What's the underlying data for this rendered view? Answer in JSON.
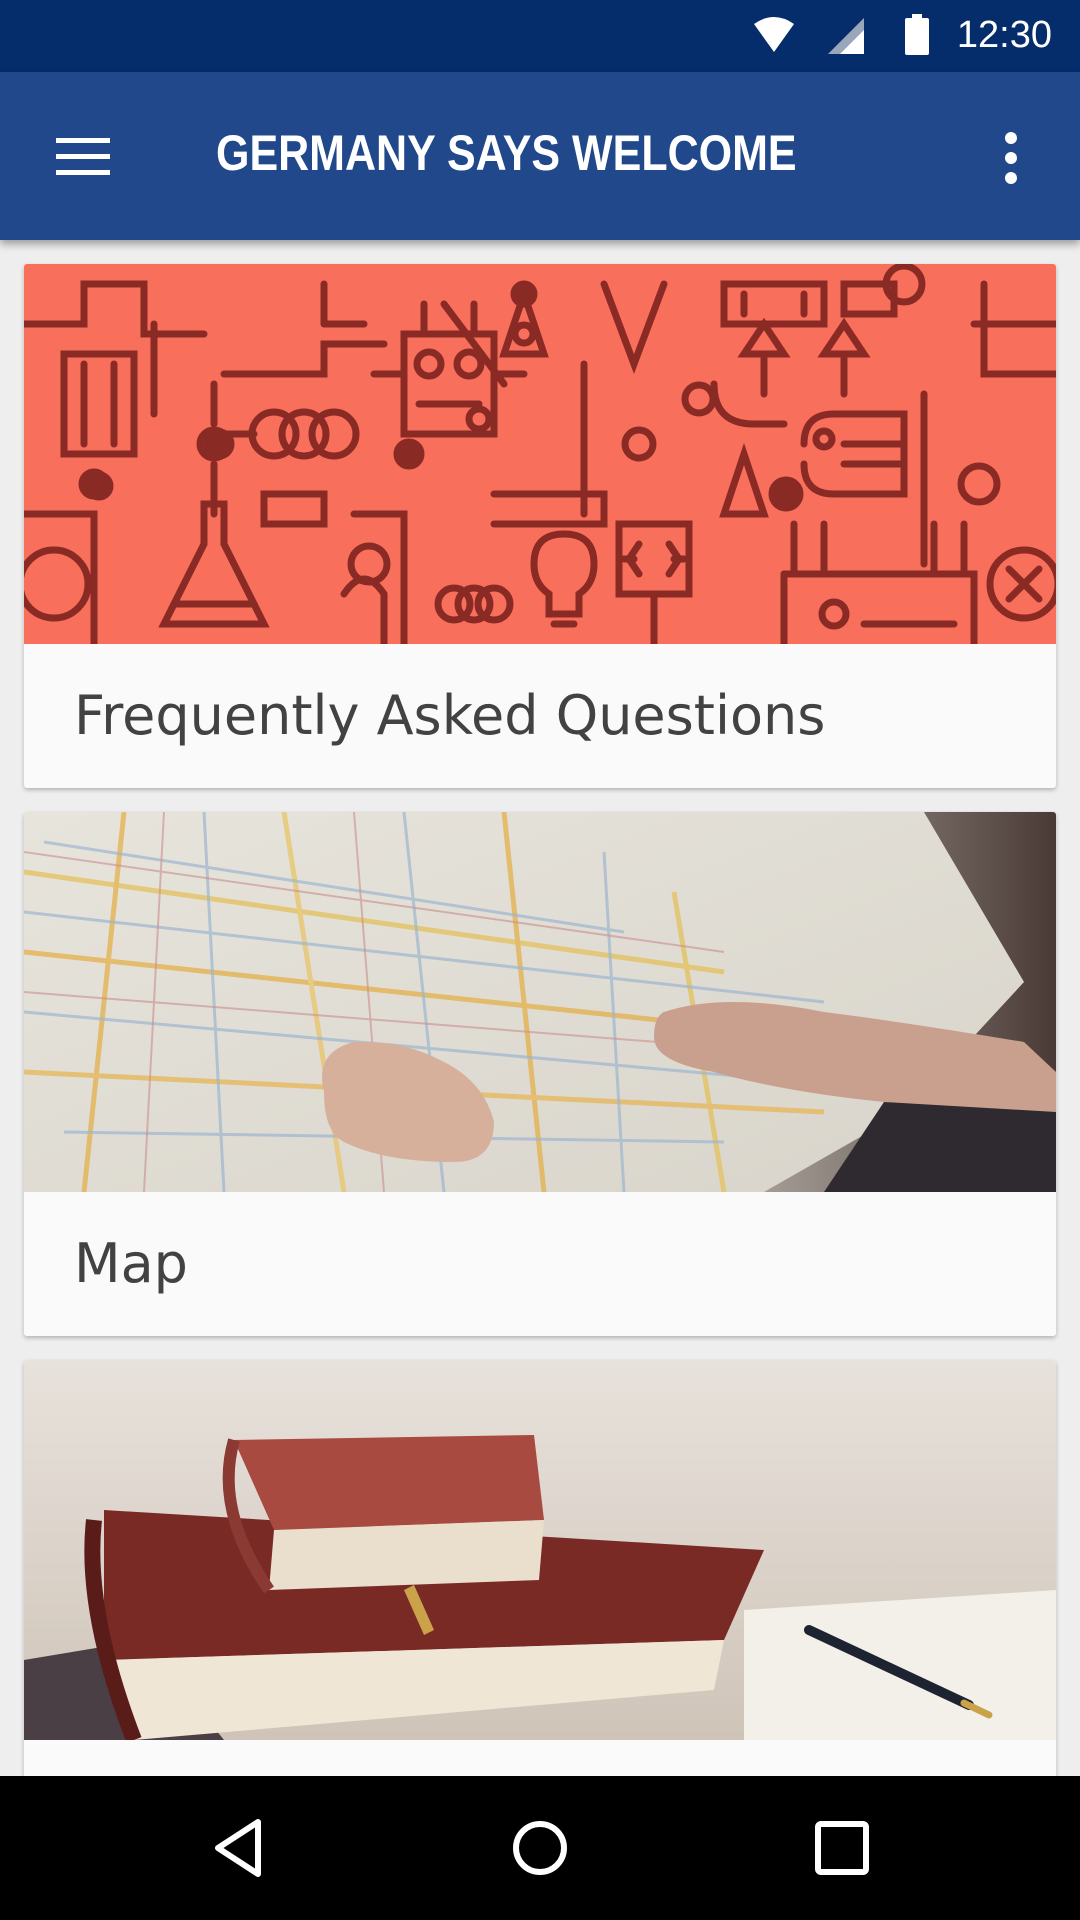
{
  "status_bar": {
    "time": "12:30",
    "icons": [
      "wifi-icon",
      "cell-signal-icon",
      "battery-icon"
    ]
  },
  "app_bar": {
    "title": "GERMANY SAYS WELCOME",
    "menu_icon": "hamburger-menu-icon",
    "more_icon": "more-vertical-icon",
    "background": "#21488a"
  },
  "cards": [
    {
      "label": "Frequently Asked Questions",
      "image": "doodle-illustration"
    },
    {
      "label": "Map",
      "image": "hand-holding-city-map-photo"
    },
    {
      "label": "",
      "image": "books-and-pen-photo"
    }
  ],
  "nav_bar": {
    "icons": [
      "back-icon",
      "home-icon",
      "recents-icon"
    ]
  },
  "colors": {
    "status_bar": "#052d6b",
    "faq_image_bg": "#f86f5c",
    "faq_image_lines": "#8a2a24"
  }
}
